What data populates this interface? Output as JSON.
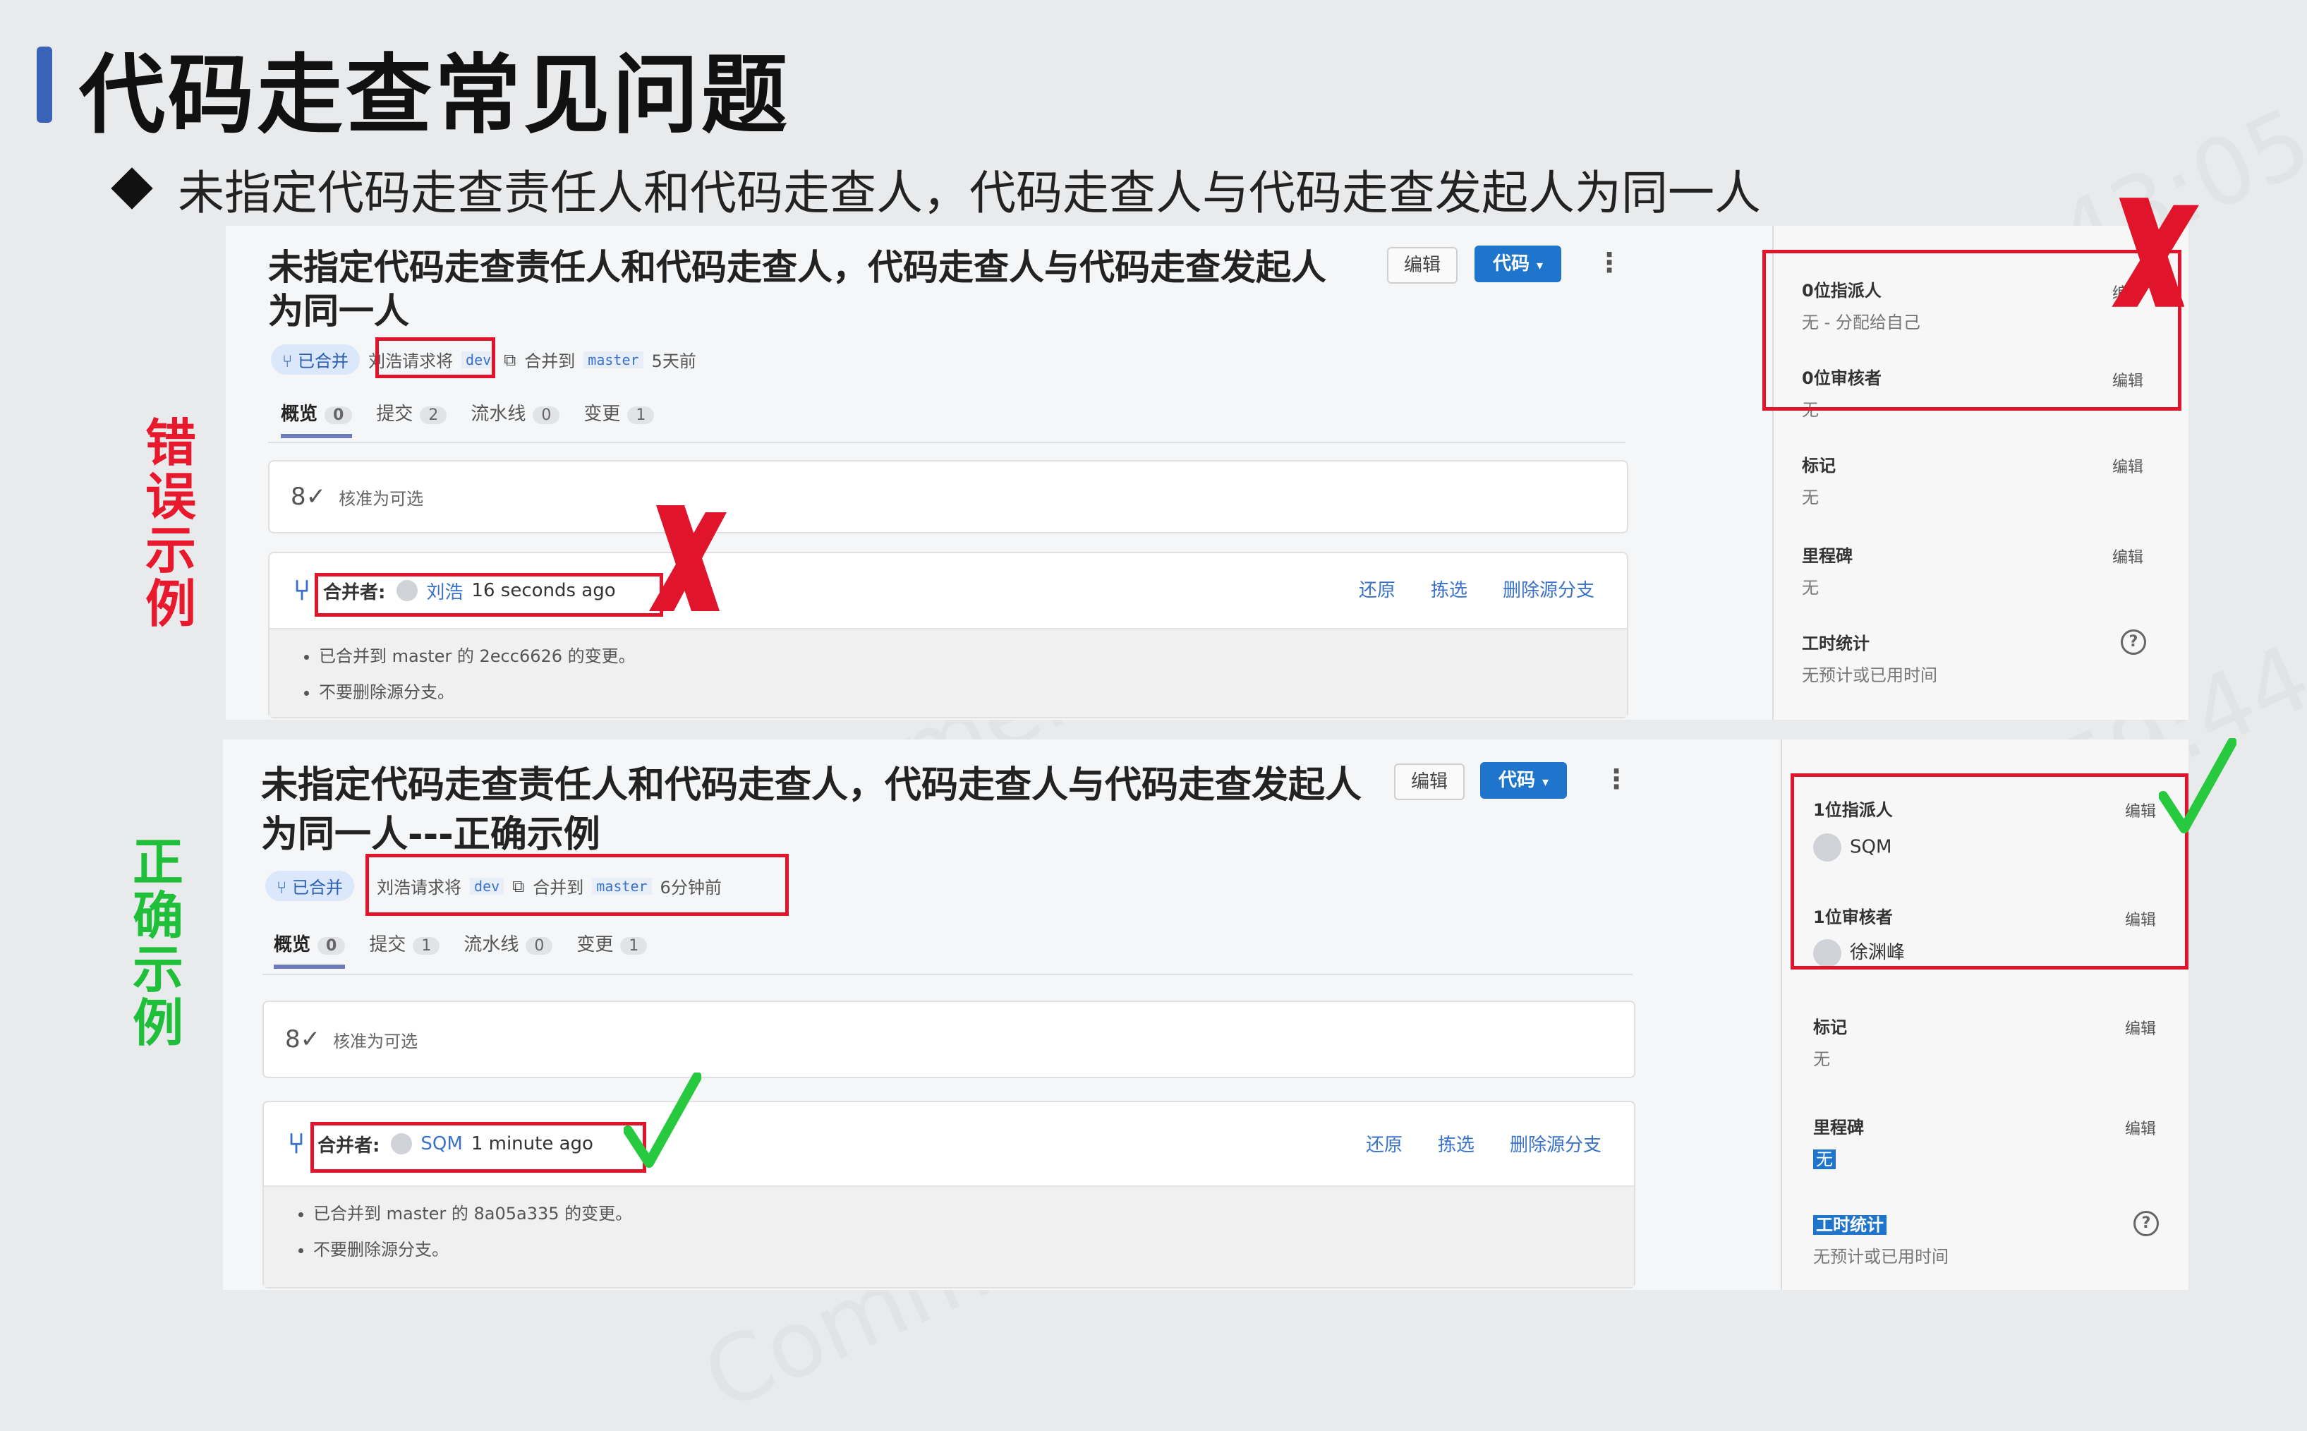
{
  "slide": {
    "title": "代码走查常见问题",
    "bullet": "未指定代码走查责任人和代码走查人，代码走查人与代码走查发起人为同一人",
    "label_wrong": "错误示例",
    "label_right": "正确示例"
  },
  "wrong": {
    "title": "未指定代码走查责任人和代码走查人，代码走查人与代码走查发起人为同一人",
    "edit_btn": "编辑",
    "code_btn": "代码",
    "status": "已合并",
    "requester": "刘浩请求将",
    "source_branch": "dev",
    "merge_into": "合并到",
    "target_branch": "master",
    "time": "5天前",
    "tabs": [
      {
        "label": "概览",
        "count": "0"
      },
      {
        "label": "提交",
        "count": "2"
      },
      {
        "label": "流水线",
        "count": "0"
      },
      {
        "label": "变更",
        "count": "1"
      }
    ],
    "approval": "核准为可选",
    "merged_by_label": "合并者:",
    "merged_by_user": "刘浩",
    "merged_time": "16 seconds ago",
    "actions": [
      "还原",
      "拣选",
      "删除源分支"
    ],
    "notes": [
      "已合并到 master 的 2ecc6626 的变更。",
      "不要删除源分支。"
    ],
    "sidebar": {
      "assignee_h": "0位指派人",
      "assignee_v": "无 - 分配给自己",
      "reviewer_h": "0位审核者",
      "reviewer_v": "无",
      "labels_h": "标记",
      "labels_v": "无",
      "milestone_h": "里程碑",
      "milestone_v": "无",
      "time_h": "工时统计",
      "time_v": "无预计或已用时间",
      "edit": "编辑"
    }
  },
  "right": {
    "title": "未指定代码走查责任人和代码走查人，代码走查人与代码走查发起人为同一人---正确示例",
    "edit_btn": "编辑",
    "code_btn": "代码",
    "status": "已合并",
    "requester": "刘浩请求将",
    "source_branch": "dev",
    "merge_into": "合并到",
    "target_branch": "master",
    "time": "6分钟前",
    "tabs": [
      {
        "label": "概览",
        "count": "0"
      },
      {
        "label": "提交",
        "count": "1"
      },
      {
        "label": "流水线",
        "count": "0"
      },
      {
        "label": "变更",
        "count": "1"
      }
    ],
    "approval": "核准为可选",
    "merged_by_label": "合并者:",
    "merged_by_user": "SQM",
    "merged_time": "1 minute ago",
    "actions": [
      "还原",
      "拣选",
      "删除源分支"
    ],
    "notes": [
      "已合并到 master 的 8a05a335 的变更。",
      "不要删除源分支。"
    ],
    "sidebar": {
      "assignee_h": "1位指派人",
      "assignee_v": "SQM",
      "reviewer_h": "1位审核者",
      "reviewer_v": "徐渊峰",
      "labels_h": "标记",
      "labels_v": "无",
      "milestone_h": "里程碑",
      "milestone_v": "无",
      "time_h": "工时统计",
      "time_v": "无预计或已用时间",
      "edit": "编辑"
    }
  },
  "colors": {
    "accent": "#1f75cb",
    "error": "#e0142a",
    "ok": "#1fbf3a",
    "wrong_label": "#e8192c"
  }
}
